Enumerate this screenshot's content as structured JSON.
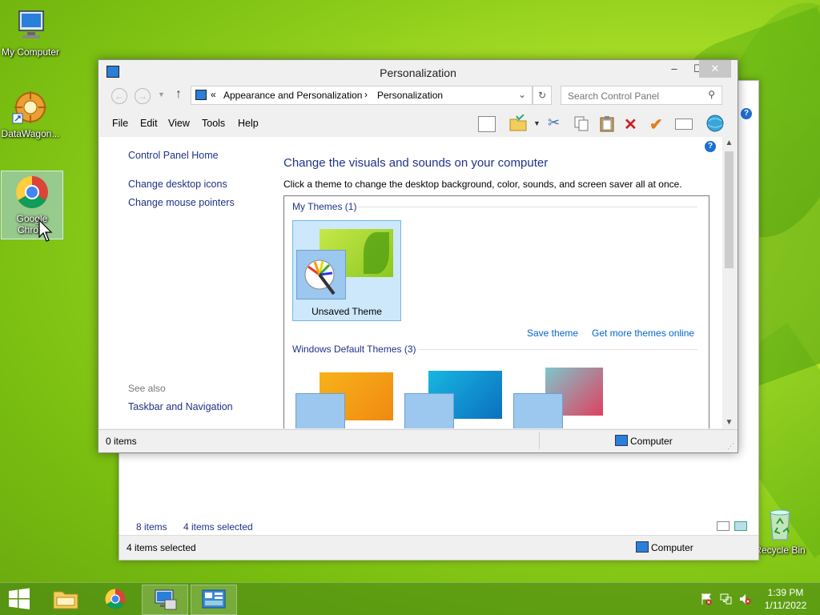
{
  "desktop": {
    "icons": [
      {
        "label": "My Computer",
        "icon": "computer-icon"
      },
      {
        "label": "DataWagon...",
        "icon": "shortcut-icon"
      },
      {
        "label": "Google Chrom",
        "icon": "chrome-icon"
      },
      {
        "label": "Recycle Bin",
        "icon": "recycle-bin-icon"
      }
    ]
  },
  "back_window": {
    "items_count": "8 items",
    "items_selected": "4 items selected",
    "status_left": "4 items selected",
    "status_right": "Computer"
  },
  "window": {
    "title": "Personalization",
    "controls": {
      "minimize": "–",
      "maximize": "☐",
      "close": "✕"
    },
    "address": {
      "prefix": "«",
      "crumbs": [
        "Appearance and Personalization",
        "Personalization"
      ],
      "separator": "›"
    },
    "search": {
      "placeholder": "Search Control Panel"
    },
    "menu": [
      "File",
      "Edit",
      "View",
      "Tools",
      "Help"
    ],
    "sidebar": {
      "home": "Control Panel Home",
      "links": [
        "Change desktop icons",
        "Change mouse pointers"
      ],
      "see_also": "See also",
      "see_also_links": [
        "Taskbar and Navigation"
      ]
    },
    "main": {
      "heading": "Change the visuals and sounds on your computer",
      "subheading": "Click a theme to change the desktop background, color, sounds, and screen saver all at once.",
      "my_themes_title": "My Themes (1)",
      "unsaved_theme": "Unsaved Theme",
      "save_theme": "Save theme",
      "get_more": "Get more themes online",
      "default_themes_title": "Windows Default Themes (3)"
    },
    "status": {
      "left": "0 items",
      "right": "Computer"
    }
  },
  "taskbar": {
    "clock_time": "1:39 PM",
    "clock_date": "1/11/2022"
  }
}
